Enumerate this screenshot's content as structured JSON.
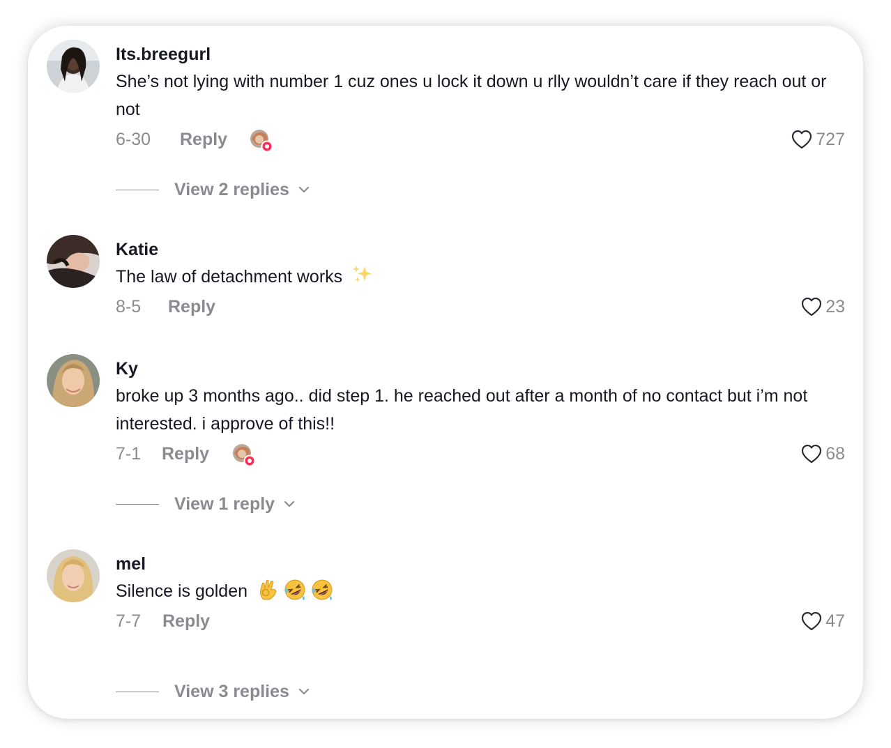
{
  "comments": [
    {
      "username": "Its.breegurl",
      "text": "She’s not lying with number 1 cuz ones u lock it down u rlly wouldn’t care if they reach out or not",
      "date": "6-30",
      "reply_label": "Reply",
      "likes": "727",
      "creator_liked": true,
      "view_replies": "View 2 replies"
    },
    {
      "username": "Katie",
      "text": "The law of detachment works",
      "emoji": "sparkles",
      "date": "8-5",
      "reply_label": "Reply",
      "likes": "23",
      "creator_liked": false
    },
    {
      "username": "Ky",
      "text": "broke up 3 months ago.. did step 1. he reached out after a month of no contact but i’m not interested. i approve of this!!",
      "date": "7-1",
      "reply_label": "Reply",
      "likes": "68",
      "creator_liked": true,
      "view_replies": "View 1 reply"
    },
    {
      "username": "mel",
      "text": "Silence is golden",
      "emoji": "ok-hand, rofl, rofl",
      "date": "7-7",
      "reply_label": "Reply",
      "likes": "47",
      "creator_liked": false,
      "view_replies": "View 3 replies"
    }
  ],
  "icons": {
    "like": "heart-outline-icon",
    "expand": "chevron-down-icon",
    "creator_liked": "creator-liked-badge-icon"
  },
  "colors": {
    "text_primary": "#161823",
    "text_secondary": "#8a8b91",
    "creator_badge": "#fe2c55"
  }
}
